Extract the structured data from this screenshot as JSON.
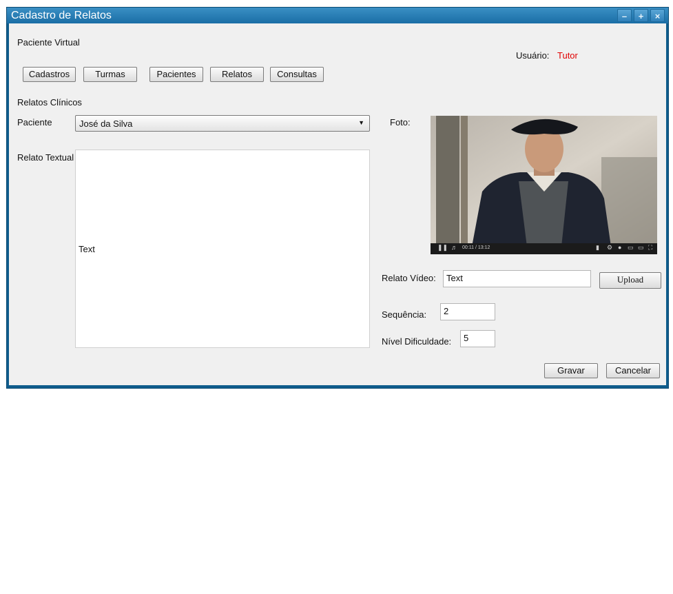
{
  "window": {
    "title": "Cadastro de Relatos"
  },
  "header": {
    "app_name": "Paciente Virtual",
    "user_label": "Usuário:",
    "user_value": "Tutor",
    "user_value_color": "#e00000"
  },
  "nav": {
    "buttons": [
      {
        "label": "Cadastros"
      },
      {
        "label": "Turmas"
      },
      {
        "label": "Pacientes"
      },
      {
        "label": "Relatos"
      },
      {
        "label": "Consultas"
      }
    ]
  },
  "section_title": "Relatos Clínicos",
  "form": {
    "paciente_label": "Paciente",
    "paciente_value": "José da Silva",
    "relato_textual_label": "Relato Textual",
    "relato_textual_value": "Text",
    "foto_label": "Foto:",
    "relato_video_label": "Relato Vídeo:",
    "relato_video_value": "Text",
    "upload_label": "Upload",
    "sequencia_label": "Sequência:",
    "sequencia_value": "2",
    "nivel_label": "Nível Dificuldade:",
    "nivel_value": "5"
  },
  "video_controls": {
    "time": "00:11 / 13:12"
  },
  "actions": {
    "save_label": "Gravar",
    "cancel_label": "Cancelar"
  }
}
